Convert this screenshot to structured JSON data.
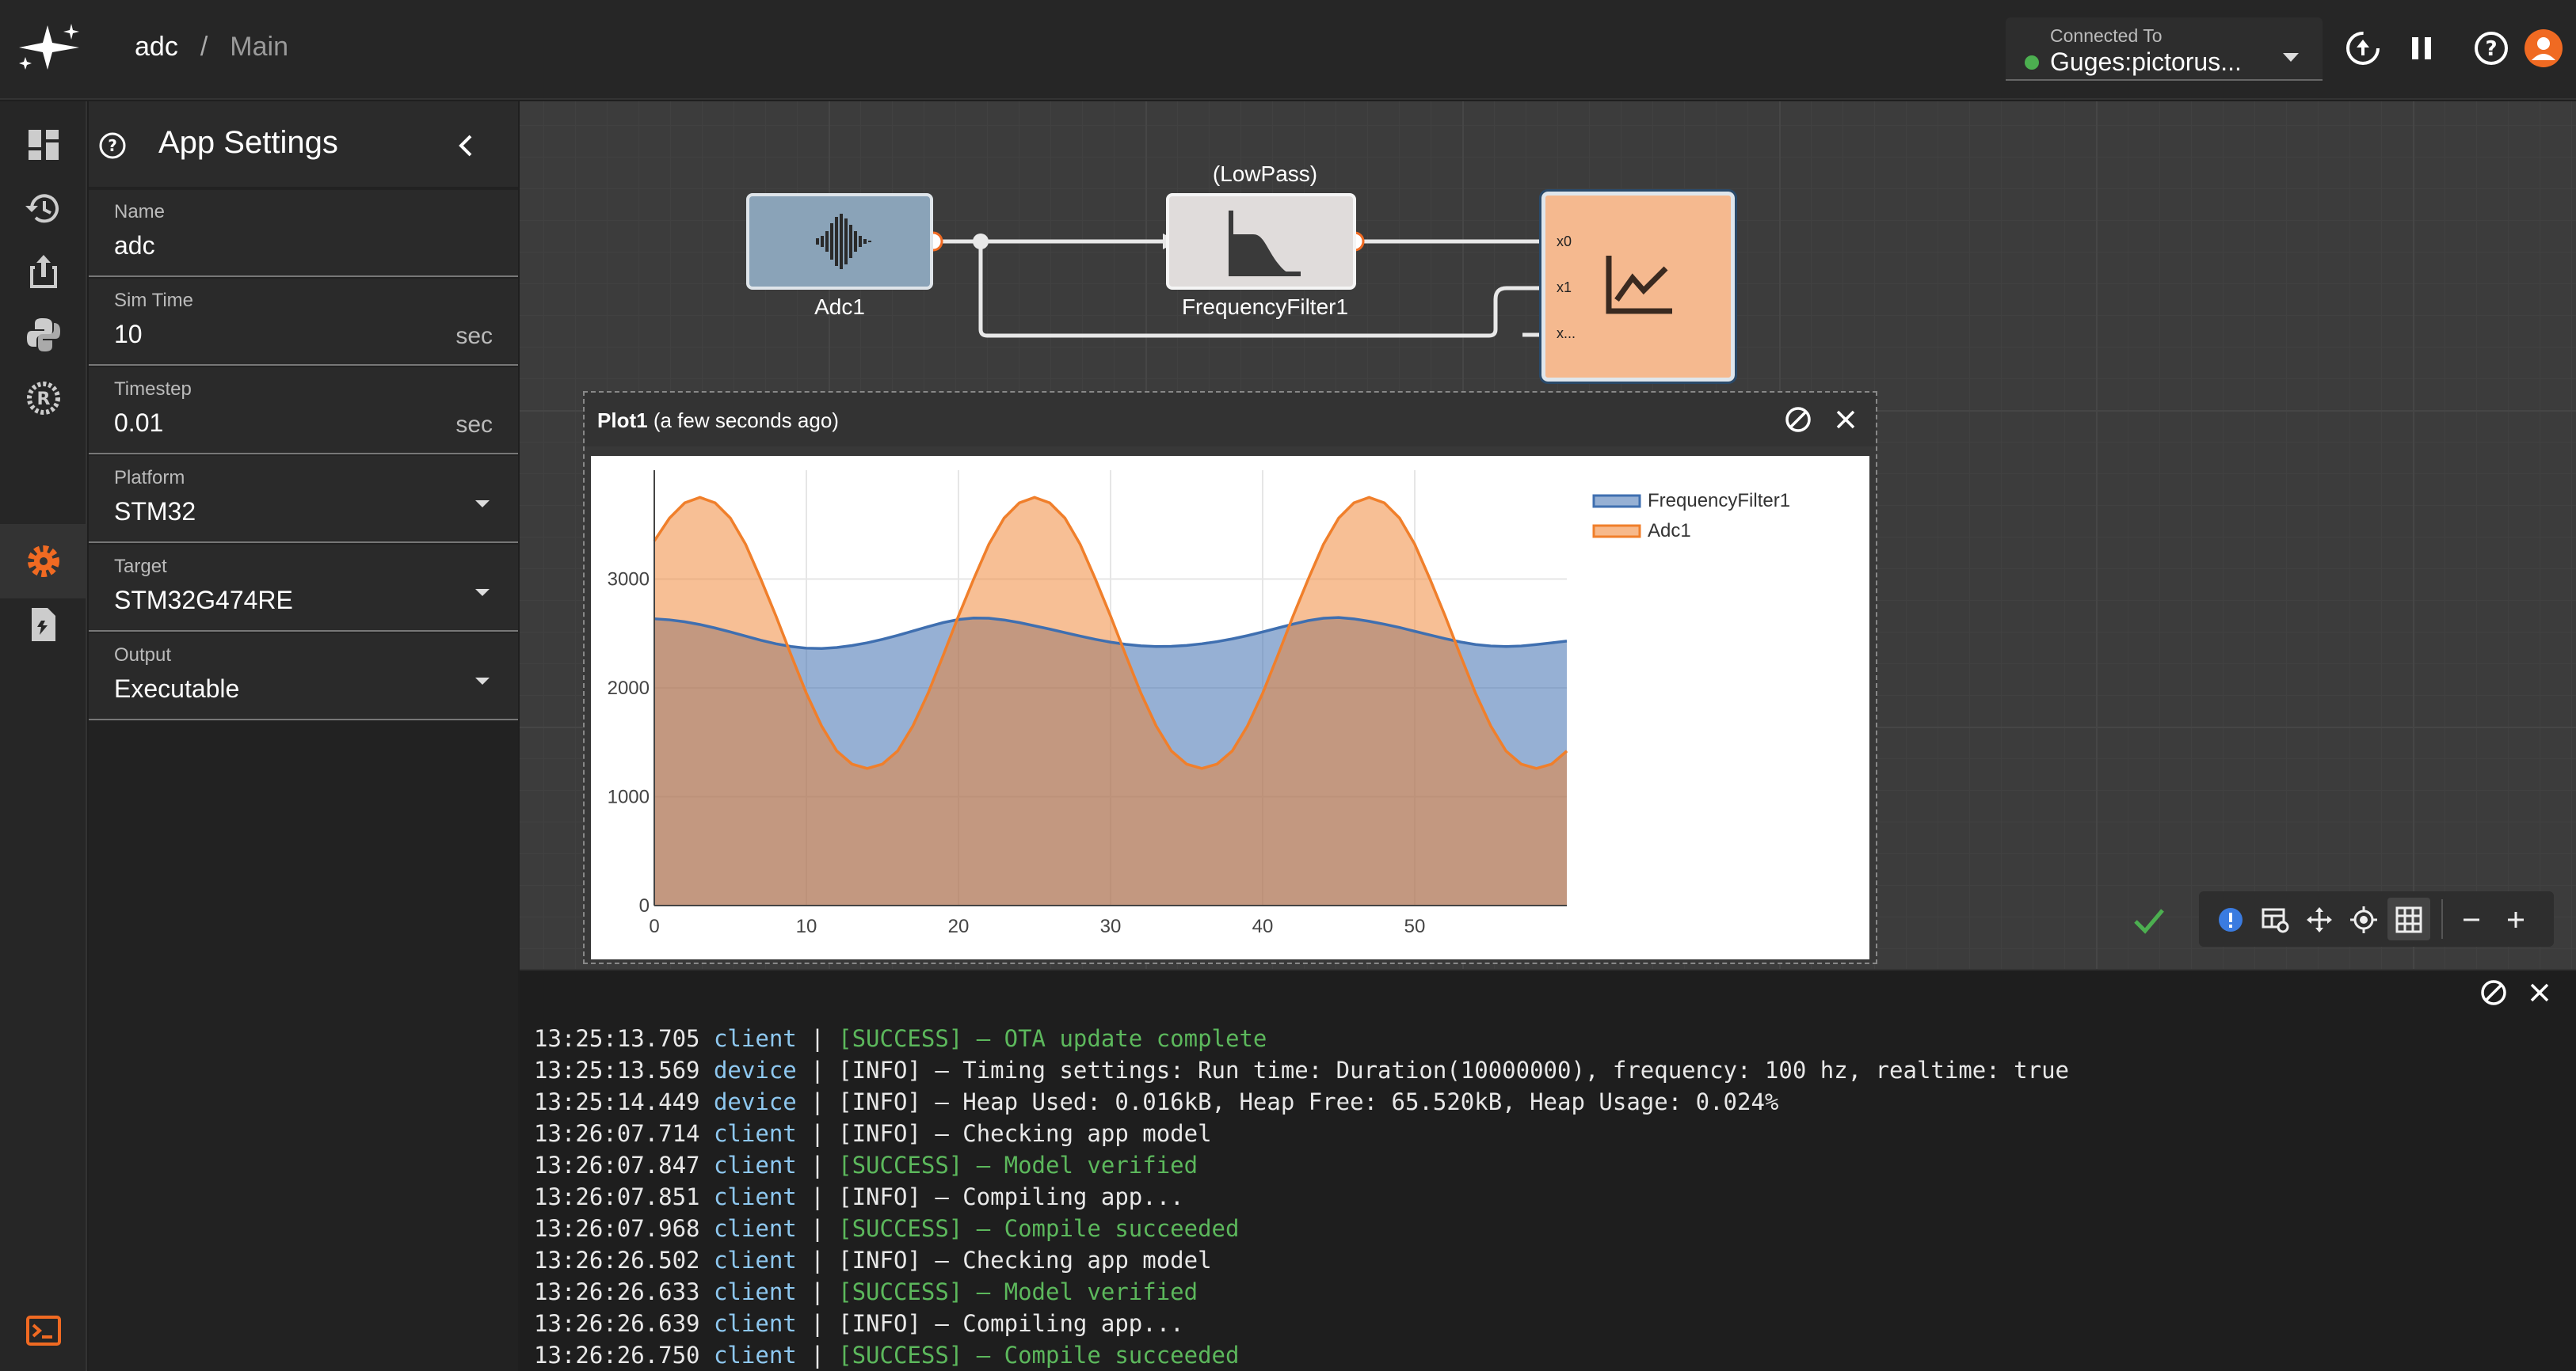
{
  "header": {
    "project": "adc",
    "separator": "/",
    "page": "Main",
    "connection_label": "Connected To",
    "connection_value": "Guges:pictorus...",
    "status_color": "#4caf50"
  },
  "icons": {
    "logo": "sparkle-logo-icon",
    "rail": [
      "dashboard-icon",
      "history-icon",
      "share-icon",
      "python-icon",
      "rust-icon",
      "settings-icon",
      "script-file-icon",
      "terminal-icon"
    ],
    "top": [
      "deploy-icon",
      "pause-icon",
      "help-icon",
      "avatar-icon"
    ]
  },
  "panel": {
    "title": "App Settings",
    "fields": [
      {
        "label": "Name",
        "value": "adc",
        "unit": ""
      },
      {
        "label": "Sim Time",
        "value": "10",
        "unit": "sec"
      },
      {
        "label": "Timestep",
        "value": "0.01",
        "unit": "sec"
      },
      {
        "label": "Platform",
        "value": "STM32",
        "unit": ""
      },
      {
        "label": "Target",
        "value": "STM32G474RE",
        "unit": ""
      },
      {
        "label": "Output",
        "value": "Executable",
        "unit": ""
      }
    ]
  },
  "diagram": {
    "blocks": [
      {
        "name": "Adc1",
        "caption": ""
      },
      {
        "name": "FrequencyFilter1",
        "caption": "(LowPass)"
      },
      {
        "name": "Plot1",
        "caption": ""
      }
    ],
    "plot_ports": [
      "x0",
      "x1",
      "x..."
    ]
  },
  "plot_window": {
    "title": "Plot1",
    "subtitle": "(a few seconds ago)"
  },
  "chart_data": {
    "type": "area",
    "x": [
      0,
      1,
      2,
      3,
      4,
      5,
      6,
      7,
      8,
      9,
      10,
      11,
      12,
      13,
      14,
      15,
      16,
      17,
      18,
      19,
      20,
      21,
      22,
      23,
      24,
      25,
      26,
      27,
      28,
      29,
      30,
      31,
      32,
      33,
      34,
      35,
      36,
      37,
      38,
      39,
      40,
      41,
      42,
      43,
      44,
      45,
      46,
      47,
      48,
      49,
      50,
      51,
      52,
      53,
      54,
      55,
      56,
      57,
      58,
      59,
      60
    ],
    "series": [
      {
        "name": "FrequencyFilter1",
        "color": "#3f6fb0",
        "values": [
          2635,
          2625,
          2607,
          2582,
          2550,
          2514,
          2476,
          2438,
          2405,
          2380,
          2365,
          2362,
          2371,
          2389,
          2414,
          2446,
          2482,
          2522,
          2562,
          2600,
          2628,
          2642,
          2640,
          2624,
          2600,
          2570,
          2540,
          2508,
          2476,
          2446,
          2420,
          2400,
          2386,
          2380,
          2382,
          2390,
          2405,
          2425,
          2450,
          2480,
          2514,
          2550,
          2586,
          2618,
          2640,
          2646,
          2634,
          2612,
          2585,
          2555,
          2520,
          2486,
          2452,
          2422,
          2398,
          2385,
          2380,
          2385,
          2398,
          2414,
          2430
        ]
      },
      {
        "name": "Adc1",
        "color": "#f07f2b",
        "values": [
          3350,
          3560,
          3700,
          3750,
          3700,
          3560,
          3320,
          3000,
          2660,
          2300,
          1950,
          1650,
          1420,
          1300,
          1260,
          1300,
          1420,
          1650,
          1950,
          2300,
          2660,
          3000,
          3320,
          3560,
          3700,
          3750,
          3700,
          3560,
          3320,
          3000,
          2660,
          2300,
          1950,
          1650,
          1420,
          1300,
          1260,
          1300,
          1420,
          1650,
          1950,
          2300,
          2660,
          3000,
          3320,
          3560,
          3700,
          3750,
          3700,
          3560,
          3320,
          3000,
          2660,
          2300,
          1950,
          1650,
          1420,
          1300,
          1260,
          1300,
          1420
        ]
      }
    ],
    "xticks": [
      0,
      10,
      20,
      30,
      40,
      50
    ],
    "yticks": [
      0,
      1000,
      2000,
      3000
    ],
    "xlim": [
      0,
      60
    ],
    "ylim": [
      0,
      4000
    ],
    "legend": "top-right",
    "grid": true
  },
  "console": {
    "lines": [
      {
        "ts": "13:25:13.705",
        "src": "client",
        "level": "ok",
        "msg": "[SUCCESS] – OTA update complete"
      },
      {
        "ts": "13:25:13.569",
        "src": "device",
        "level": "info",
        "msg": "[INFO] – Timing settings: Run time: Duration(10000000), frequency: 100 hz, realtime: true"
      },
      {
        "ts": "13:25:14.449",
        "src": "device",
        "level": "info",
        "msg": "[INFO] – Heap Used: 0.016kB, Heap Free: 65.520kB, Heap Usage: 0.024%"
      },
      {
        "ts": "13:26:07.714",
        "src": "client",
        "level": "info",
        "msg": "[INFO] – Checking app model"
      },
      {
        "ts": "13:26:07.847",
        "src": "client",
        "level": "ok",
        "msg": "[SUCCESS] – Model verified"
      },
      {
        "ts": "13:26:07.851",
        "src": "client",
        "level": "info",
        "msg": "[INFO] – Compiling app..."
      },
      {
        "ts": "13:26:07.968",
        "src": "client",
        "level": "ok",
        "msg": "[SUCCESS] – Compile succeeded"
      },
      {
        "ts": "13:26:26.502",
        "src": "client",
        "level": "info",
        "msg": "[INFO] – Checking app model"
      },
      {
        "ts": "13:26:26.633",
        "src": "client",
        "level": "ok",
        "msg": "[SUCCESS] – Model verified"
      },
      {
        "ts": "13:26:26.639",
        "src": "client",
        "level": "info",
        "msg": "[INFO] – Compiling app..."
      },
      {
        "ts": "13:26:26.750",
        "src": "client",
        "level": "ok",
        "msg": "[SUCCESS] – Compile succeeded"
      }
    ]
  }
}
